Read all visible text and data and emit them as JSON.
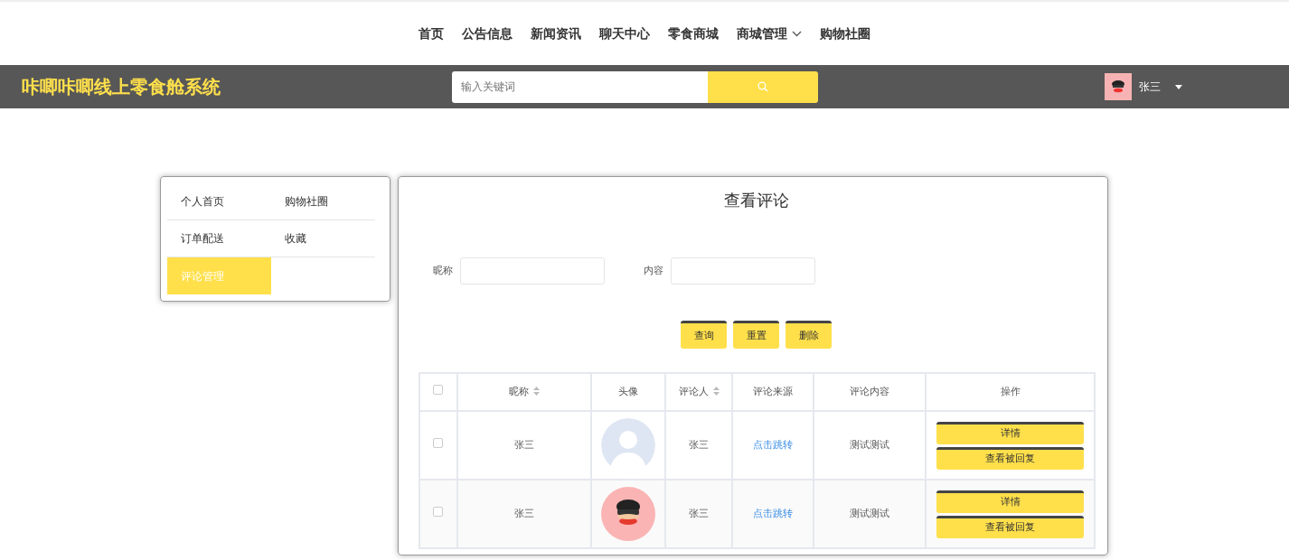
{
  "top_nav": [
    {
      "label": "首页",
      "has_menu": false
    },
    {
      "label": "公告信息",
      "has_menu": false
    },
    {
      "label": "新闻资讯",
      "has_menu": false
    },
    {
      "label": "聊天中心",
      "has_menu": false
    },
    {
      "label": "零食商城",
      "has_menu": false
    },
    {
      "label": "商城管理",
      "has_menu": true
    },
    {
      "label": "购物社圈",
      "has_menu": false
    }
  ],
  "header": {
    "brand": "咔唧咔唧线上零食舱系统",
    "search": {
      "placeholder": "输入关键词"
    },
    "user": {
      "name": "张三"
    }
  },
  "sidebar": {
    "items": [
      {
        "label": "个人首页",
        "selected": false
      },
      {
        "label": "购物社圈",
        "selected": false
      },
      {
        "label": "订单配送",
        "selected": false
      },
      {
        "label": "收藏",
        "selected": false
      },
      {
        "label": "评论管理",
        "selected": true
      }
    ]
  },
  "panel": {
    "title": "查看评论",
    "filters": [
      {
        "label": "昵称"
      },
      {
        "label": "内容"
      }
    ],
    "buttons": [
      "查询",
      "重置",
      "删除"
    ],
    "table": {
      "select_all_checked": false,
      "columns": [
        {
          "label": "昵称",
          "sortable": true
        },
        {
          "label": "头像",
          "sortable": false
        },
        {
          "label": "评论人",
          "sortable": true
        },
        {
          "label": "评论来源",
          "sortable": false
        },
        {
          "label": "评论内容",
          "sortable": false
        },
        {
          "label": "操作",
          "sortable": false
        }
      ],
      "rows": [
        {
          "checked": false,
          "nickname": "张三",
          "avatar": {
            "kind": "default"
          },
          "commenter": "张三",
          "source": "点击跳转",
          "content": "测试测试",
          "actions": [
            "详情",
            "查看被回复"
          ]
        },
        {
          "checked": false,
          "nickname": "张三",
          "avatar": {
            "kind": "cartoon"
          },
          "commenter": "张三",
          "source": "点击跳转",
          "content": "测试测试",
          "actions": [
            "详情",
            "查看被回复"
          ]
        }
      ]
    }
  }
}
